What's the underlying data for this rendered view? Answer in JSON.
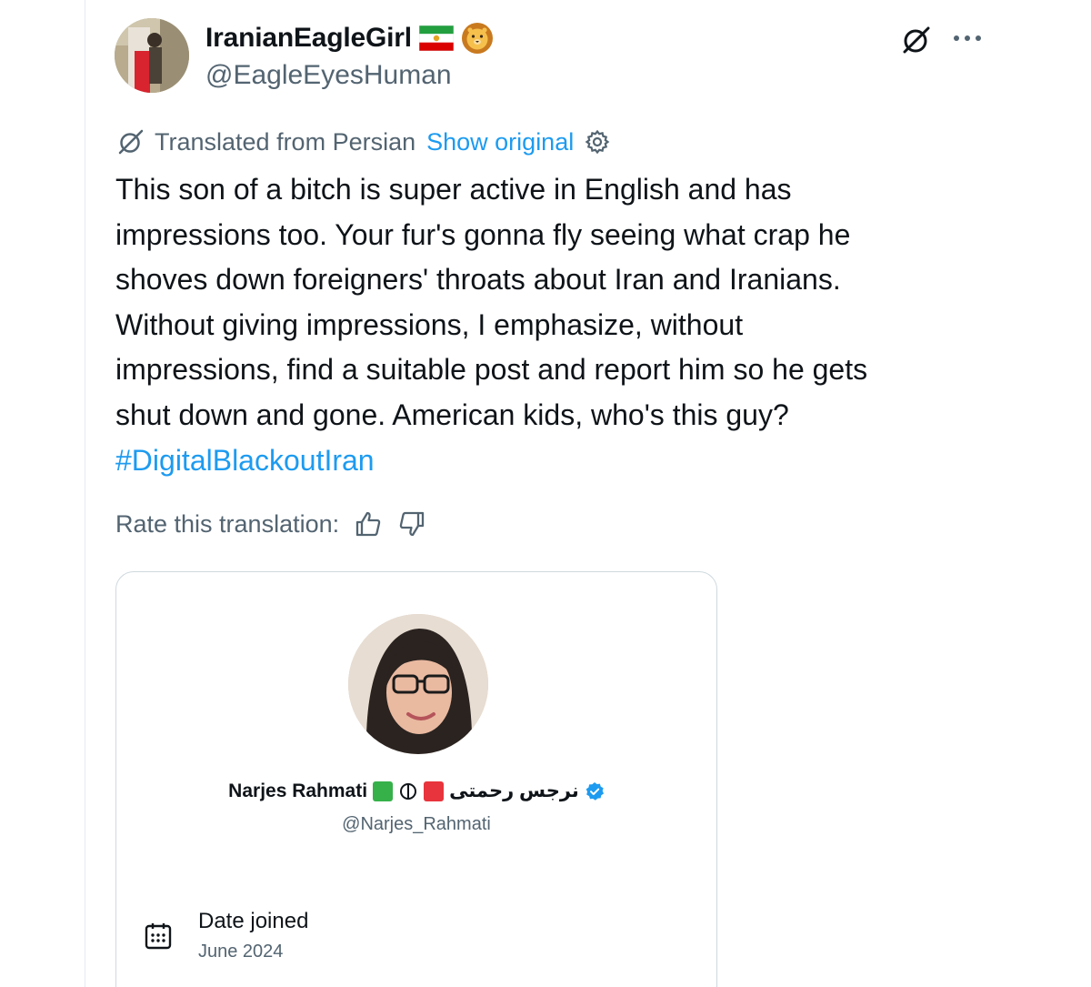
{
  "author": {
    "display_name": "IranianEagleGirl",
    "handle": "@EagleEyesHuman"
  },
  "translation": {
    "notice": "Translated from Persian",
    "show_original": "Show original"
  },
  "tweet": {
    "lines": [
      "This son of a bitch is super active in English and has",
      "impressions too. Your fur's gonna fly seeing what crap he",
      "shoves down foreigners' throats about Iran and Iranians.",
      "Without giving impressions, I emphasize, without",
      "impressions, find a suitable post and report him so he gets",
      "shut down and gone. American kids, who's this guy?"
    ],
    "hashtag": "#DigitalBlackoutIran"
  },
  "rate": {
    "label": "Rate this translation:"
  },
  "card": {
    "name": "Narjes Rahmati",
    "persian_name": "نرجس رحمتی",
    "handle": "@Narjes_Rahmati",
    "date_label": "Date joined",
    "date_value": "June 2024"
  },
  "colors": {
    "link": "#1d9bf0",
    "secondary_text": "#536471",
    "primary_text": "#0f1419",
    "border": "#cfd9de"
  },
  "icons": {
    "grok": "grok-icon",
    "more": "more-icon",
    "translate": "translate-icon",
    "settings": "gear-icon",
    "thumbs_up": "thumbs-up-icon",
    "thumbs_down": "thumbs-down-icon",
    "verified": "verified-badge-icon",
    "calendar": "calendar-icon"
  }
}
